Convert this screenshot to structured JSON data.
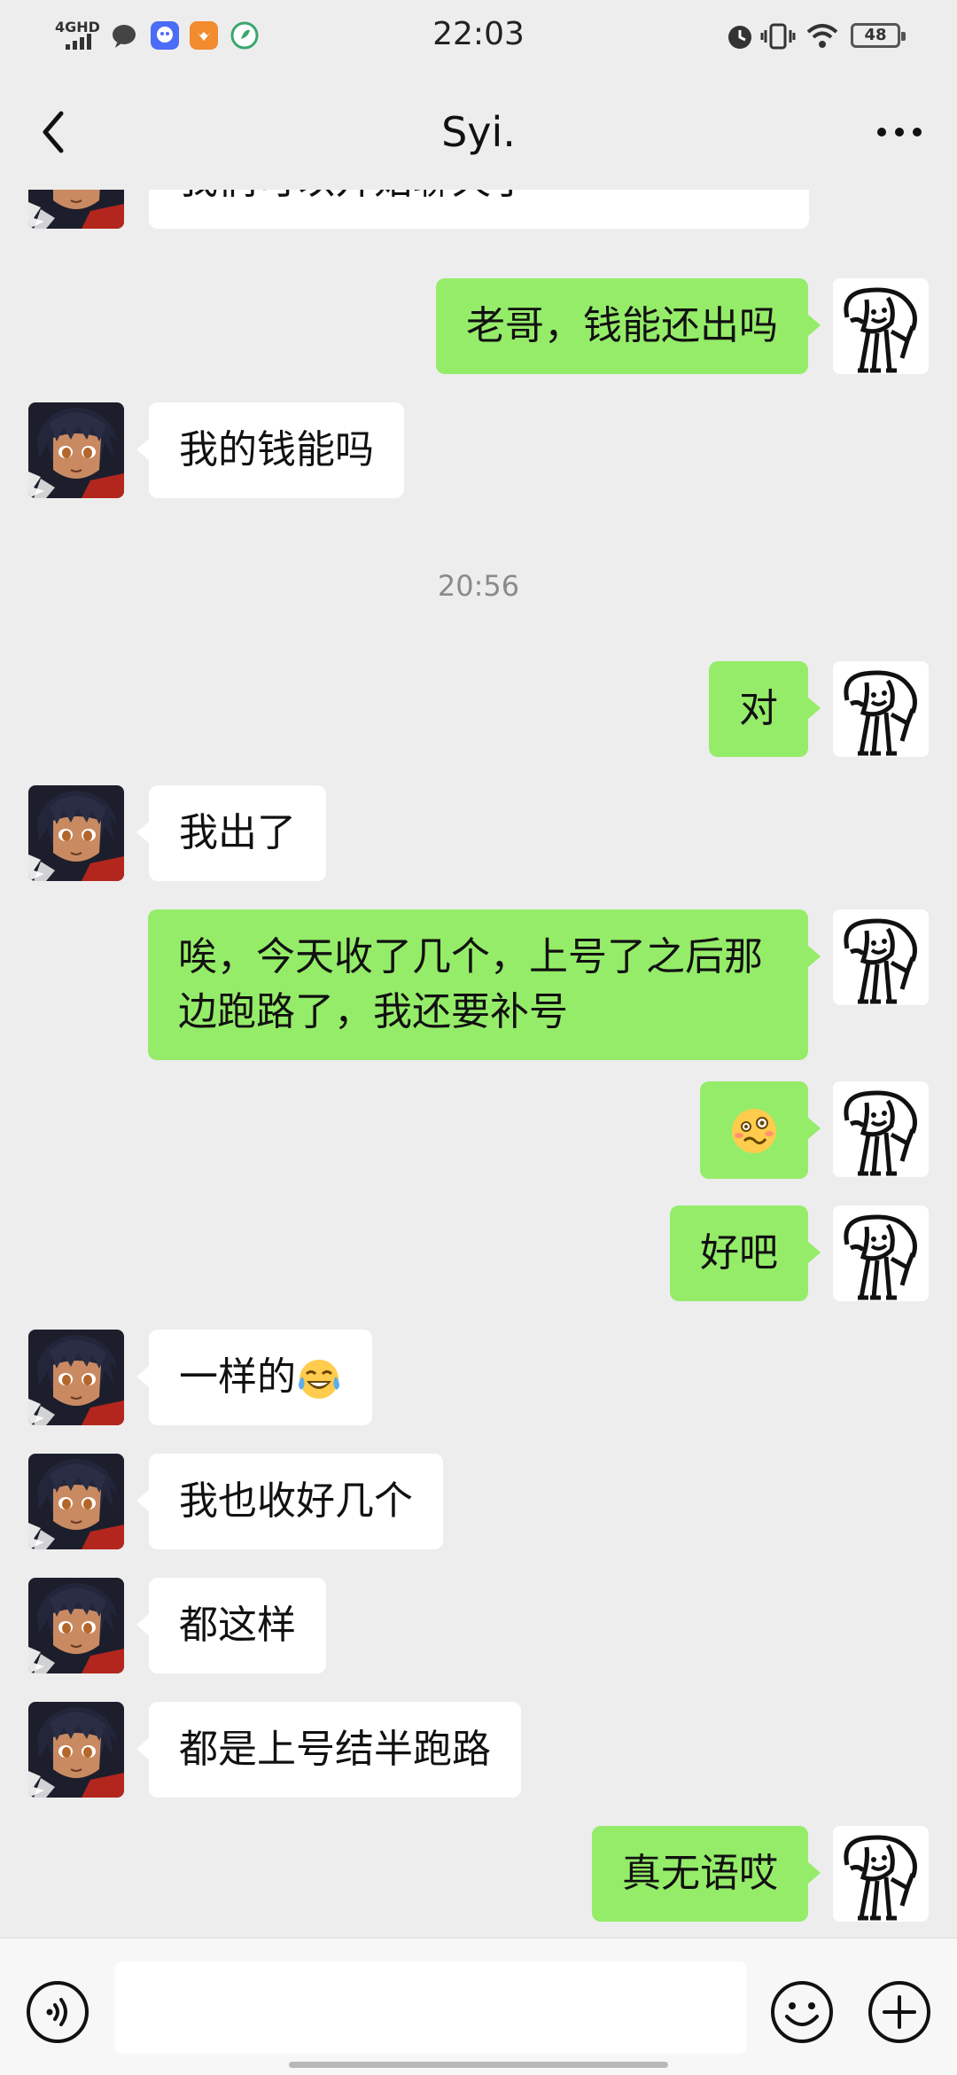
{
  "status_bar": {
    "network": "4GHD",
    "time": "22:03",
    "battery": "48"
  },
  "header": {
    "title": "Syi."
  },
  "messages": [
    {
      "side": "in",
      "text": "我们可以开始聊天了"
    },
    {
      "side": "out",
      "text": "老哥，钱能还出吗"
    },
    {
      "side": "in",
      "text": "我的钱能吗"
    },
    {
      "type": "timestamp",
      "text": "20:56"
    },
    {
      "side": "out",
      "text": "对"
    },
    {
      "side": "in",
      "text": "我出了"
    },
    {
      "side": "out",
      "text": "唉，今天收了几个，上号了之后那边跑路了，我还要补号"
    },
    {
      "side": "out",
      "sticker": "woozy-face-icon"
    },
    {
      "side": "out",
      "text": "好吧"
    },
    {
      "side": "in",
      "text": "一样的",
      "emoji": "tears-of-joy-icon"
    },
    {
      "side": "in",
      "text": "我也收好几个"
    },
    {
      "side": "in",
      "text": "都这样"
    },
    {
      "side": "in",
      "text": "都是上号结半跑路"
    },
    {
      "side": "out",
      "text": "真无语哎"
    }
  ],
  "input": {
    "value": "",
    "placeholder": ""
  },
  "colors": {
    "background": "#ededed",
    "outgoing_bubble": "#95ec69",
    "incoming_bubble": "#ffffff"
  }
}
